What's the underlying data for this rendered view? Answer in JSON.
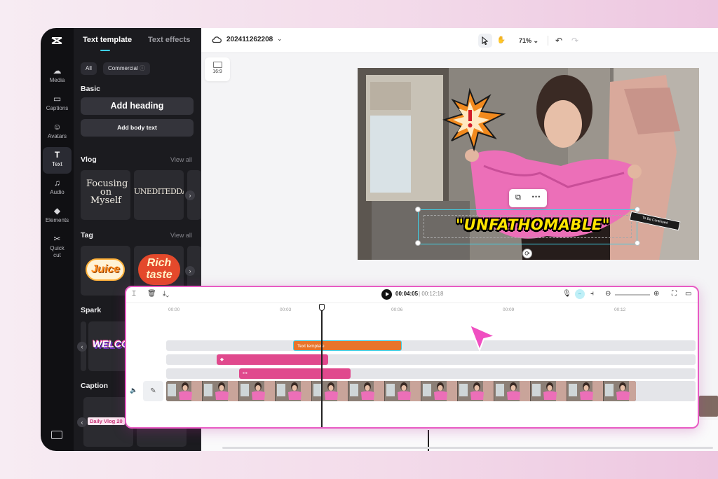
{
  "rail": {
    "items": [
      {
        "label": "Media",
        "icon": "cloud-upload-icon"
      },
      {
        "label": "Captions",
        "icon": "captions-icon"
      },
      {
        "label": "Avatars",
        "icon": "avatar-icon"
      },
      {
        "label": "Text",
        "icon": "text-icon"
      },
      {
        "label": "Audio",
        "icon": "music-note-icon"
      },
      {
        "label": "Elements",
        "icon": "shapes-icon"
      },
      {
        "label": "Quick cut",
        "icon": "scissors-icon"
      }
    ],
    "active": "Text"
  },
  "panel": {
    "tabs": [
      "Text template",
      "Text effects"
    ],
    "filters": [
      "All",
      "Commercial"
    ],
    "basic": {
      "title": "Basic",
      "add_heading": "Add heading",
      "add_body": "Add body text"
    },
    "sections": [
      {
        "title": "Vlog",
        "view_all": "View all",
        "thumbs": [
          "Focusing on Myself",
          "UNEDITEDDAY"
        ]
      },
      {
        "title": "Tag",
        "view_all": "View all",
        "thumbs": [
          "Juice",
          "Rich taste"
        ]
      },
      {
        "title": "Spark",
        "thumbs": [
          "WELCO"
        ]
      },
      {
        "title": "Caption",
        "thumbs": [
          "Daily Vlog 20"
        ]
      }
    ]
  },
  "topbar": {
    "project_name": "202411262208",
    "zoom": "71%"
  },
  "ratio": {
    "label": "16:9"
  },
  "canvas": {
    "overlay_text": "\"UNFATHOMABLE\"",
    "sticker_text": "To Be Continued"
  },
  "timeline": {
    "current_time": "00:04:05",
    "total_time": "00:12:18",
    "ruler": [
      "00:00",
      "00:03",
      "00:06",
      "00:09",
      "00:12"
    ],
    "text_clip_label": "Text template"
  },
  "colors": {
    "accent": "#e85bc4",
    "clip_orange": "#e8742a",
    "clip_pink": "#e0498d",
    "active_cyan": "#3fd0e6"
  }
}
